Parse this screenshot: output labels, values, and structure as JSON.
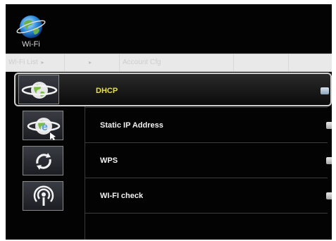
{
  "header": {
    "title": "Wi-Fi",
    "logo_icon": "globe-icon"
  },
  "tabs": [
    {
      "label": "Wi-Fi List",
      "has_arrow": true
    },
    {
      "label": "",
      "has_arrow": true
    },
    {
      "label": "Account Cfg"
    },
    {
      "label": ""
    },
    {
      "label": ""
    }
  ],
  "list": {
    "selected_index": 0,
    "items": [
      {
        "label": "DHCP",
        "icon": "globe-orbit-icon"
      },
      {
        "label": "Static IP Address",
        "icon": "globe-ie-icon"
      },
      {
        "label": "WPS",
        "icon": "wps-refresh-icon"
      },
      {
        "label": "WI-FI check",
        "icon": "wifi-signal-icon"
      }
    ]
  },
  "colors": {
    "selected_text": "#e8e14a",
    "background": "#030303",
    "tab_bar": "#e9e9e9"
  }
}
